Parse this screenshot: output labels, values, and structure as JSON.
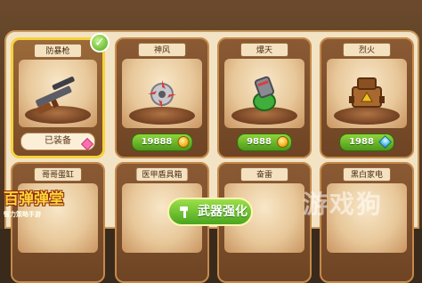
{
  "cards_row1": [
    {
      "name": "防暴枪",
      "status": "已装备",
      "selected": true,
      "art": "riot-gun-icon"
    },
    {
      "name": "神风",
      "price": "19888",
      "currency": "gold-coin-icon",
      "art": "wind-blade-icon"
    },
    {
      "name": "爆天",
      "price": "9888",
      "currency": "gold-coin-icon",
      "art": "bomb-launcher-icon"
    },
    {
      "name": "烈火",
      "price": "1988",
      "currency": "diamond-gem-icon",
      "art": "fire-cannon-icon"
    }
  ],
  "cards_row2": [
    {
      "name": "哥哥蛋缸"
    },
    {
      "name": "医甲盾具箱"
    },
    {
      "name": "奋雷"
    },
    {
      "name": "黑白家电"
    }
  ],
  "upgrade_button": {
    "label": "武器强化",
    "icon": "hammer-icon"
  },
  "logo": {
    "title": "百弹弹堂",
    "subtitle": "智力策略手游"
  },
  "watermark": "游戏狗",
  "colors": {
    "selected_border": "#f7d23a",
    "price_green": "#4c9a1a",
    "card_brown": "#7a4c28"
  }
}
